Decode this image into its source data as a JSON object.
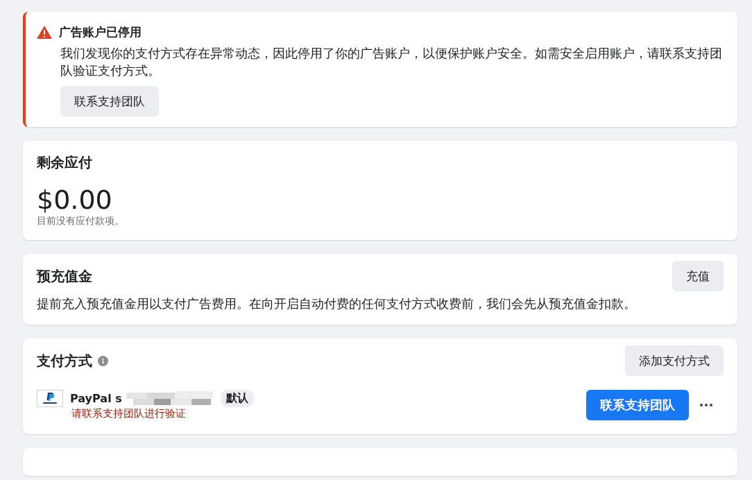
{
  "alert": {
    "title": "广告账户已停用",
    "message": "我们发现你的支付方式存在异常动态，因此停用了你的广告账户，以便保护账户安全。如需安全启用账户，请联系支持团队验证支付方式。",
    "button": "联系支持团队"
  },
  "balance": {
    "title": "剩余应付",
    "amount": "$0.00",
    "note": "目前没有应付款项。"
  },
  "prepaid": {
    "title": "预充值金",
    "button": "充值",
    "description": "提前充入预充值金用以支付广告费用。在向开启自动付费的任何支付方式收费前，我们会先从预充值金扣款。"
  },
  "payment_methods": {
    "title": "支付方式",
    "add_button": "添加支付方式",
    "methods": [
      {
        "name": "PayPal s",
        "redacted": true,
        "badge": "默认",
        "warning": "请联系支持团队进行验证",
        "button": "联系支持团队"
      }
    ]
  }
}
